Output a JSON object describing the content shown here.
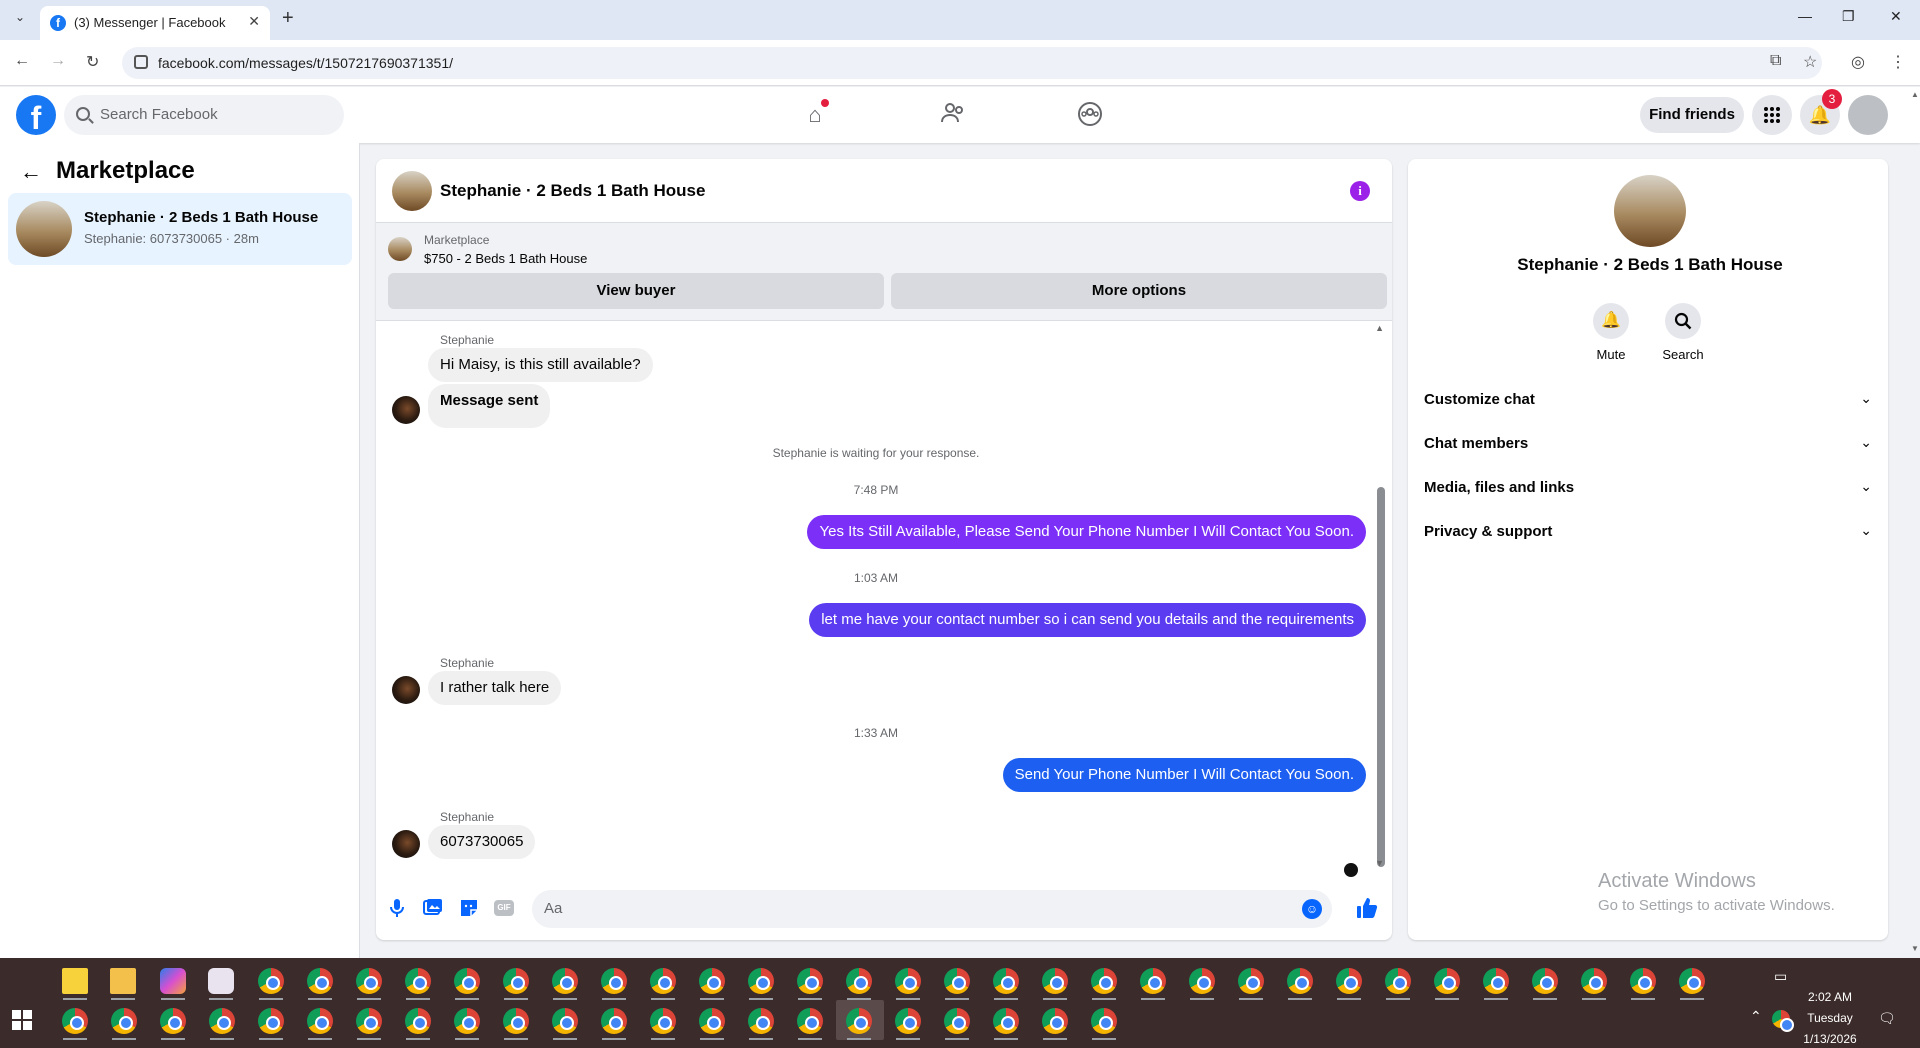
{
  "browser": {
    "tab_title": "(3) Messenger | Facebook",
    "url": "facebook.com/messages/t/1507217690371351/"
  },
  "header": {
    "search_placeholder": "Search Facebook",
    "find_friends_label": "Find friends",
    "notification_count": "3"
  },
  "left": {
    "title": "Marketplace",
    "conversation": {
      "name": "Stephanie · 2 Beds 1 Bath House",
      "preview": "Stephanie: 6073730065 · 28m"
    }
  },
  "chat": {
    "title": "Stephanie · 2 Beds 1 Bath House",
    "banner": {
      "label": "Marketplace",
      "item": "$750 - 2 Beds 1 Bath House",
      "view_buyer": "View buyer",
      "more_options": "More options"
    },
    "messages": {
      "sender1": "Stephanie",
      "in1": "Hi Maisy, is this still available?",
      "in2": "Message sent",
      "waiting": "Stephanie is waiting for your response.",
      "time1": "7:48 PM",
      "out1": "Yes Its Still Available, Please Send Your Phone Number I Will Contact You Soon.",
      "time2": "1:03 AM",
      "out2": "let me have your contact number so i can send you details and the requirements",
      "sender2": "Stephanie",
      "in3": "I rather talk here",
      "time3": "1:33 AM",
      "out3": "Send Your Phone Number I Will Contact You Soon.",
      "sender3": "Stephanie",
      "in4": "6073730065"
    },
    "composer_placeholder": "Aa",
    "colors": {
      "out_purple": "#7b2ff7",
      "out_mid": "#5b3cf0",
      "out_blue": "#1d5ff0"
    }
  },
  "right": {
    "name": "Stephanie · 2 Beds 1 Bath House",
    "mute": "Mute",
    "search": "Search",
    "sections": [
      "Customize chat",
      "Chat members",
      "Media, files and links",
      "Privacy & support"
    ]
  },
  "watermark": {
    "line1": "Activate Windows",
    "line2": "Go to Settings to activate Windows."
  },
  "taskbar": {
    "time": "2:02 AM",
    "day": "Tuesday",
    "date": "1/13/2026"
  }
}
